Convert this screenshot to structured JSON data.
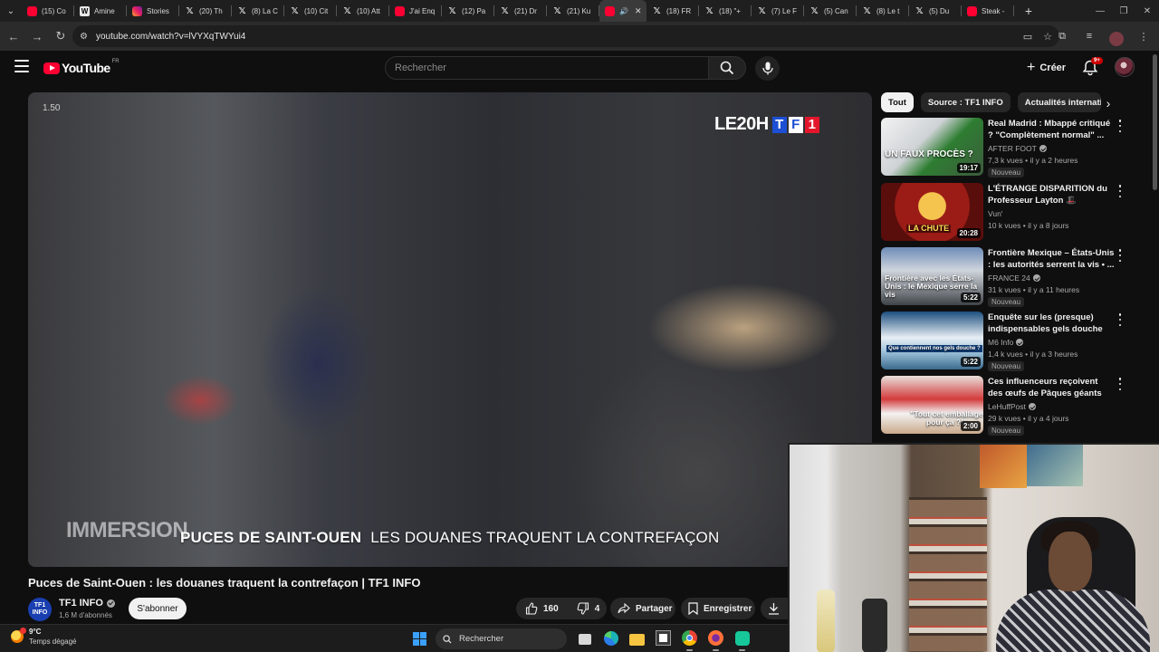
{
  "browser": {
    "tabs": [
      {
        "icon": "youtube",
        "label": "(15) Co"
      },
      {
        "icon": "wiki",
        "label": "Amine"
      },
      {
        "icon": "instagram",
        "label": "Stories"
      },
      {
        "icon": "x",
        "label": "(20) Th"
      },
      {
        "icon": "x",
        "label": "(8) La C"
      },
      {
        "icon": "x",
        "label": "(10) Cit"
      },
      {
        "icon": "x",
        "label": "(10) Att"
      },
      {
        "icon": "youtube",
        "label": "J'ai Enq"
      },
      {
        "icon": "x",
        "label": "(12) Pa"
      },
      {
        "icon": "x",
        "label": "(21) Dr"
      },
      {
        "icon": "x",
        "label": "(21) Ku"
      },
      {
        "icon": "youtube",
        "label": "",
        "active": true
      },
      {
        "icon": "x",
        "label": "(18) FR"
      },
      {
        "icon": "x",
        "label": "(18) \"+"
      },
      {
        "icon": "x",
        "label": "(7) Le F"
      },
      {
        "icon": "x",
        "label": "(5) Can"
      },
      {
        "icon": "x",
        "label": "(8) Le t"
      },
      {
        "icon": "x",
        "label": "(5) Du"
      },
      {
        "icon": "youtube",
        "label": "Steak -"
      }
    ],
    "url": "youtube.com/watch?v=lVYXqTWYui4"
  },
  "masthead": {
    "logo_text": "YouTube",
    "country_code": "FR",
    "search_placeholder": "Rechercher",
    "create_label": "Créer",
    "notifications_badge": "9+"
  },
  "player": {
    "speed_tag": "1.50",
    "bug_text": "LE20H",
    "bug_letters": [
      "T",
      "F",
      "1"
    ],
    "overlay_immersion": "IMMERSION",
    "overlay_main": "PUCES DE SAINT-OUEN",
    "overlay_sub": "LES DOUANES TRAQUENT LA CONTREFAÇON"
  },
  "video": {
    "title": "Puces de Saint-Ouen : les douanes traquent la contrefaçon | TF1 INFO",
    "channel_name": "TF1 INFO",
    "channel_avatar_lines": [
      "TF1",
      "INFO"
    ],
    "subscribers": "1,6 M d'abonnés",
    "subscribe_label": "S'abonner",
    "likes": "160",
    "dislikes": "4",
    "share_label": "Partager",
    "save_label": "Enregistrer"
  },
  "sidebar": {
    "chips": [
      "Tout",
      "Source : TF1 INFO",
      "Actualités internatio"
    ],
    "recommendations": [
      {
        "title": "Real Madrid : Mbappé critiqué ? \"Complètement normal\" ...",
        "channel": "AFTER FOOT",
        "verified": true,
        "meta": "7,3 k vues • il y a 2 heures",
        "badge": "Nouveau",
        "duration": "19:17",
        "thumb_text": "UN FAUX PROCÈS ?"
      },
      {
        "title": "L'ÉTRANGE DISPARITION du Professeur Layton 🎩",
        "channel": "Vun'",
        "verified": false,
        "meta": "10 k vues • il y a 8 jours",
        "badge": "",
        "duration": "20:28",
        "thumb_text": "LA CHUTE"
      },
      {
        "title": "Frontière Mexique – États-Unis : les autorités serrent la vis • ...",
        "channel": "FRANCE 24",
        "verified": true,
        "meta": "31 k vues • il y a 11 heures",
        "badge": "Nouveau",
        "duration": "5:22",
        "thumb_text": "Frontière avec les États-Unis : le Mexique serre la vis"
      },
      {
        "title": "Enquête sur les (presque) indispensables gels douche",
        "channel": "M6 Info",
        "verified": true,
        "meta": "1,4 k vues • il y a 3 heures",
        "badge": "Nouveau",
        "duration": "5:22",
        "thumb_text": "Que contiennent nos gels douche ?"
      },
      {
        "title": "Ces influenceurs reçoivent des œufs de Pâques géants Kinder...",
        "channel": "LeHuffPost",
        "verified": true,
        "meta": "29 k vues • il y a 4 jours",
        "badge": "Nouveau",
        "duration": "2:00",
        "thumb_text": "\"Tout cet emballage pour ça ?!\""
      }
    ]
  },
  "taskbar": {
    "temperature": "9°C",
    "weather": "Temps dégagé",
    "search_label": "Rechercher"
  }
}
